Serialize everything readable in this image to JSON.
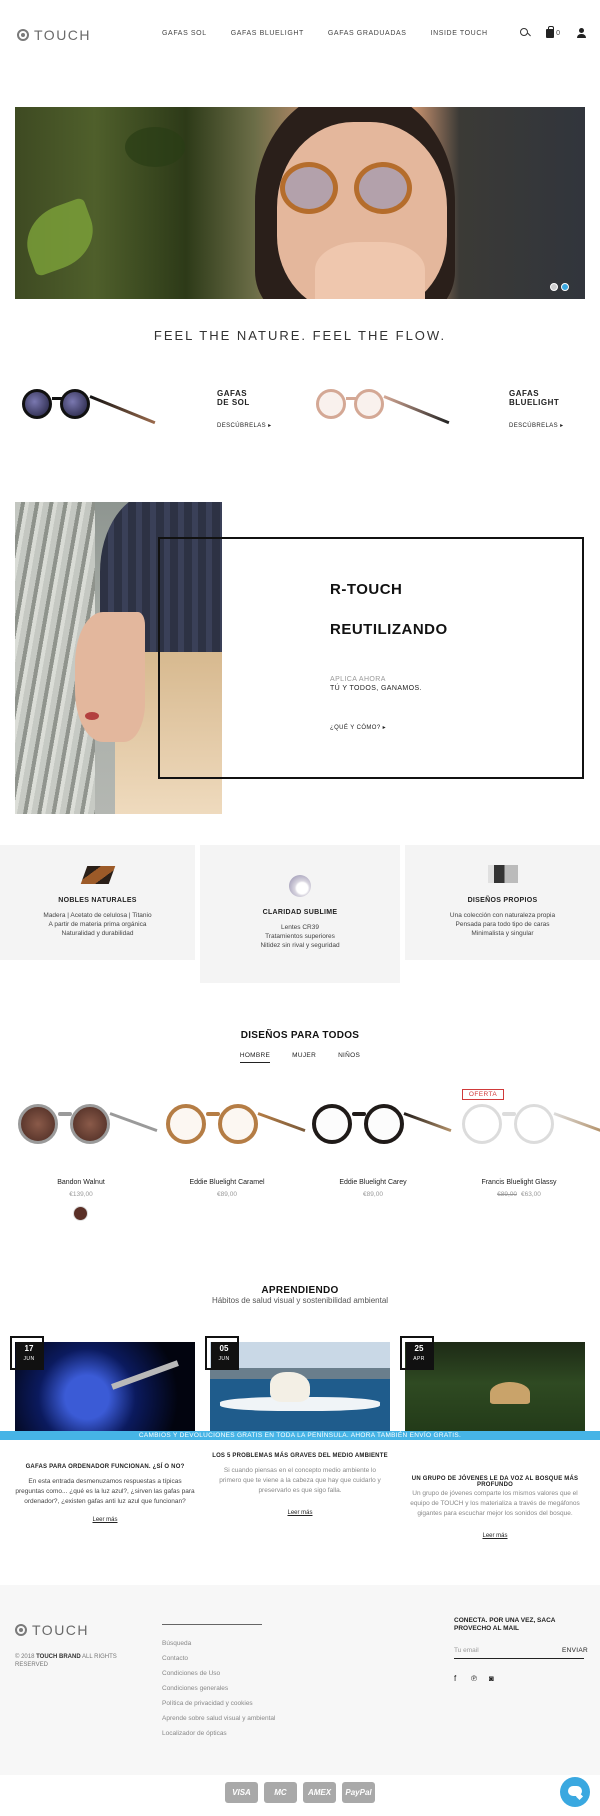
{
  "header": {
    "logo": "TOUCH",
    "nav": [
      "GAFAS SOL",
      "GAFAS BLUELIGHT",
      "GAFAS GRADUADAS",
      "INSIDE TOUCH"
    ],
    "cart_count": "0",
    "icons": [
      "search-icon",
      "bag-icon",
      "user-icon"
    ]
  },
  "hero": {
    "slides": 2,
    "active_slide": 2
  },
  "tagline": "FEEL THE NATURE. FEEL THE FLOW.",
  "categories": [
    {
      "title": "GAFAS\nDE SOL",
      "line1": "GAFAS",
      "line2": "DE SOL",
      "link": "DESCÚBRELAS ▸"
    },
    {
      "title": "GAFAS\nBLUELIGHT",
      "line1": "GAFAS",
      "line2": "BLUELIGHT",
      "link": "DESCÚBRELAS ▸"
    }
  ],
  "promo": {
    "heading1": "R-TOUCH",
    "heading2": "REUTILIZANDO",
    "sub1": "APLICA AHORA",
    "sub2": "TÚ Y TODOS, GANAMOS.",
    "link": "¿QUÉ Y CÓMO? ▸"
  },
  "features": [
    {
      "title": "NOBLES NATURALES",
      "lines": [
        "Madera | Acetato de celulosa | Titanio",
        "A partir de materia prima orgánica",
        "Naturalidad y durabilidad"
      ]
    },
    {
      "title": "CLARIDAD SUBLIME",
      "lines": [
        "Lentes CR39",
        "Tratamientos superiores",
        "Nitidez sin rival y seguridad"
      ]
    },
    {
      "title": "DISEÑOS PROPIOS",
      "lines": [
        "Una colección con naturaleza propia",
        "Pensada para todo tipo de caras",
        "Minimalista y singular"
      ]
    }
  ],
  "products_section": {
    "title": "DISEÑOS PARA TODOS",
    "tabs": [
      "HOMBRE",
      "MUJER",
      "NIÑOS"
    ],
    "active_tab": "HOMBRE",
    "offer_label": "OFERTA",
    "products": [
      {
        "name": "Bandon Walnut",
        "price": "€139,00"
      },
      {
        "name": "Eddie Bluelight Caramel",
        "price": "€89,00"
      },
      {
        "name": "Eddie Bluelight Carey",
        "price": "€89,00"
      },
      {
        "name": "Francis Bluelight Glassy",
        "old_price": "€89,00",
        "price": "€63,00"
      }
    ]
  },
  "blog": {
    "title": "APRENDIENDO",
    "subtitle": "Hábitos de salud visual y sostenibilidad ambiental",
    "banner": "CAMBIOS Y DEVOLUCIONES GRATIS EN TODA LA PENÍNSULA. AHORA TAMBIÉN ENVÍO GRATIS.",
    "posts": [
      {
        "day": "17",
        "month": "JUN",
        "title": "GAFAS PARA ORDENADOR FUNCIONAN. ¿SÍ O NO?",
        "text": [
          "En esta entrada desmenuzamos respuestas a típicas",
          "preguntas como... ¿qué es la luz azul?, ¿sirven las gafas para",
          "ordenador?, ¿existen gafas anti luz azul que funcionan?"
        ],
        "more": "Leer más"
      },
      {
        "day": "05",
        "month": "JUN",
        "title": "LOS 5 PROBLEMAS MÁS GRAVES DEL MEDIO AMBIENTE",
        "text": [
          "Si cuando piensas en el concepto medio ambiente lo",
          "primero que te viene a la cabeza que hay que cuidarlo y",
          "preservarlo es que sigo falla."
        ],
        "more": "Leer más"
      },
      {
        "day": "25",
        "month": "APR",
        "title": "UN GRUPO DE JÓVENES LE DA VOZ AL BOSQUE MÁS PROFUNDO",
        "text": [
          "Un grupo de jóvenes comparte los mismos valores que el",
          "equipo de TOUCH y los materializa a través de megáfonos",
          "gigantes para escuchar mejor los sonidos del bosque."
        ],
        "more": "Leer más"
      }
    ]
  },
  "footer": {
    "logo": "TOUCH",
    "copyright_prefix": "© 2018",
    "copyright_brand": "TOUCH BRAND",
    "copyright_suffix": "ALL RIGHTS RESERVED",
    "links": [
      "Búsqueda",
      "Contacto",
      "Condiciones de Uso",
      "Condiciones generales",
      "Política de privacidad y cookies",
      "Aprende sobre salud visual y ambiental",
      "Localizador de ópticas"
    ],
    "newsletter_title": "CONECTA. POR UNA VEZ, SACA PROVECHO AL MAIL",
    "email_placeholder": "Tu email",
    "send_label": "ENVIAR",
    "social": [
      "f",
      "℗",
      "◙"
    ],
    "payments": [
      "VISA",
      "MC",
      "AMEX",
      "PayPal"
    ]
  },
  "colors": {
    "accent": "#46b4e6",
    "offer": "#d03a3a"
  }
}
